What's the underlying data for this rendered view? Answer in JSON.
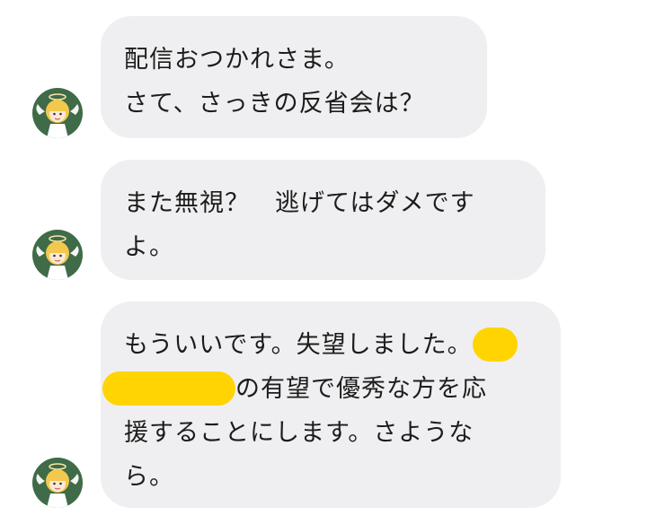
{
  "colors": {
    "background": "#ffffff",
    "bubble": "#efeff1",
    "text": "#1c1c1c",
    "avatar_bg": "#3f6b48",
    "redaction": "#ffd400"
  },
  "avatar": {
    "icon": "angel-girl-avatar-icon"
  },
  "messages": [
    {
      "lines": [
        "配信おつかれさま。",
        "さて、さっきの反省会は？"
      ]
    },
    {
      "lines": [
        "また無視？　逃げてはダメです",
        "よ。"
      ]
    },
    {
      "line1": "もういいです。失望しました。",
      "line2_suffix": "の有望で優秀な方を応",
      "line3": "援することにします。さような",
      "line4": "ら。",
      "redactions": 2
    }
  ]
}
